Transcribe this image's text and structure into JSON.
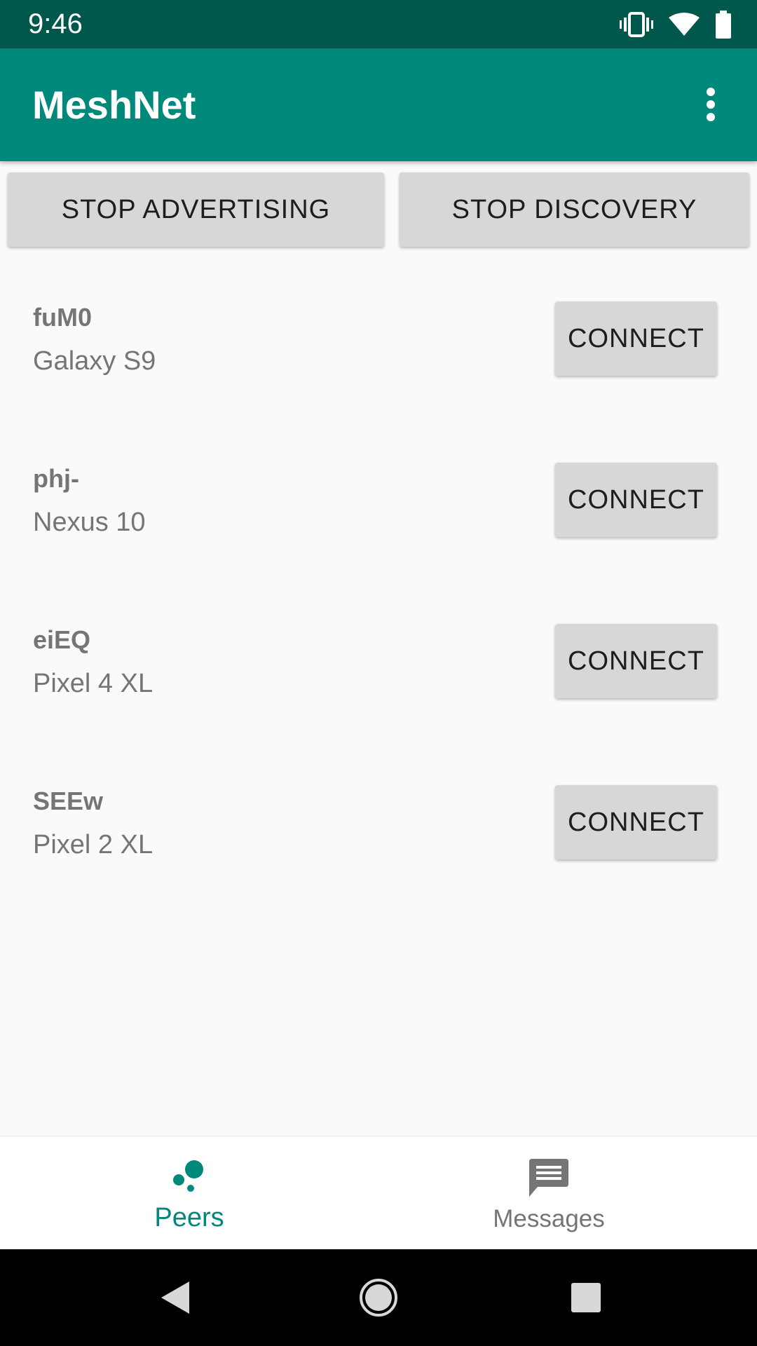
{
  "status_bar": {
    "time": "9:46",
    "icons": [
      "vibrate-icon",
      "wifi-icon",
      "battery-icon"
    ]
  },
  "app_bar": {
    "title": "MeshNet",
    "menu_icon": "more-vert-icon"
  },
  "actions": {
    "stop_advertising": "STOP ADVERTISING",
    "stop_discovery": "STOP DISCOVERY"
  },
  "peers": [
    {
      "name": "fuM0",
      "device": "Galaxy S9",
      "button": "CONNECT"
    },
    {
      "name": "phj-",
      "device": "Nexus 10",
      "button": "CONNECT"
    },
    {
      "name": "eiEQ",
      "device": "Pixel 4 XL",
      "button": "CONNECT"
    },
    {
      "name": "SEEw",
      "device": "Pixel 2 XL",
      "button": "CONNECT"
    }
  ],
  "bottom_nav": {
    "items": [
      {
        "label": "Peers",
        "icon": "peers-icon",
        "selected": true
      },
      {
        "label": "Messages",
        "icon": "message-icon",
        "selected": false
      }
    ]
  },
  "colors": {
    "status_bar": "#00574b",
    "primary": "#00897b",
    "button_bg": "#d6d7d7",
    "secondary_text": "#757575"
  }
}
